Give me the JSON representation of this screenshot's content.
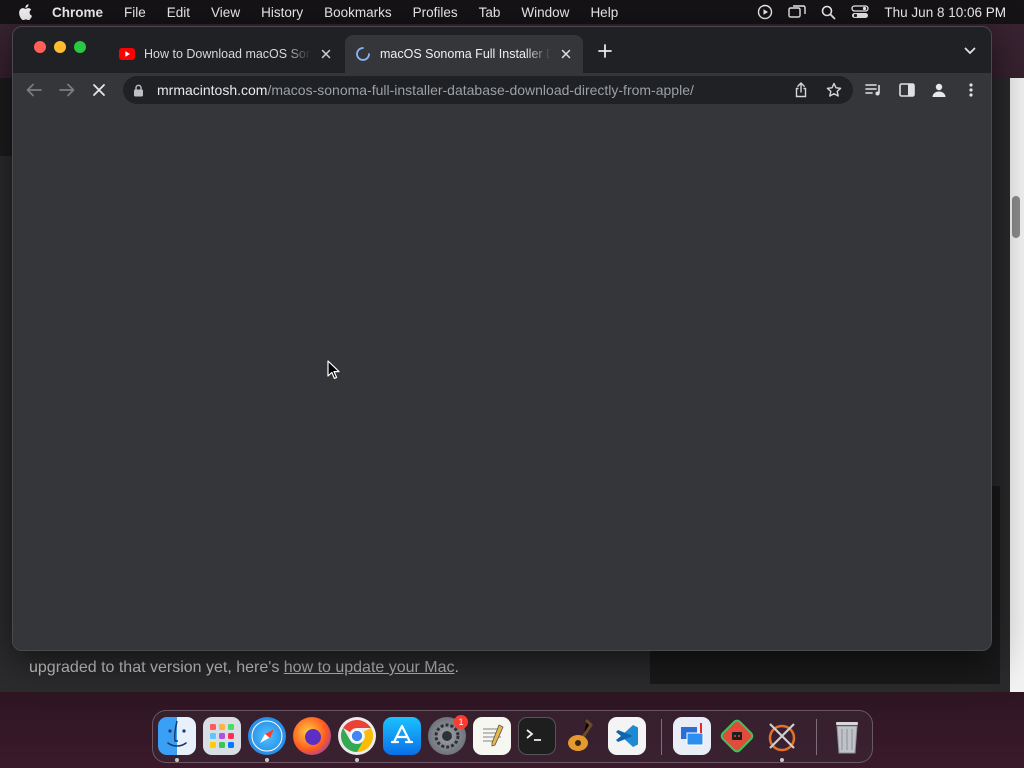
{
  "menubar": {
    "app_name": "Chrome",
    "items": [
      "File",
      "Edit",
      "View",
      "History",
      "Bookmarks",
      "Profiles",
      "Tab",
      "Window",
      "Help"
    ],
    "clock": "Thu Jun 8  10:06 PM"
  },
  "browser": {
    "tabs": [
      {
        "title": "How to Download macOS Sonoma",
        "favicon": "youtube-icon",
        "state": "inactive"
      },
      {
        "title": "macOS Sonoma Full Installer Database",
        "favicon": "loading-spinner-icon",
        "state": "active"
      }
    ],
    "url_host": "mrmacintosh.com",
    "url_path": "/macos-sonoma-full-installer-database-download-directly-from-apple/"
  },
  "background_page": {
    "text_before_link": "upgraded to that version yet, here's ",
    "link_text": "how to update your Mac",
    "text_after_link": "."
  },
  "dock": {
    "apps": [
      {
        "name": "Finder",
        "icon": "finder-icon",
        "running": true
      },
      {
        "name": "Launchpad",
        "icon": "launchpad-icon",
        "running": false
      },
      {
        "name": "Safari",
        "icon": "safari-icon",
        "running": true
      },
      {
        "name": "Firefox",
        "icon": "firefox-icon",
        "running": false
      },
      {
        "name": "Chrome",
        "icon": "chrome-icon",
        "running": true
      },
      {
        "name": "App Store",
        "icon": "app-store-icon",
        "running": false
      },
      {
        "name": "System Settings",
        "icon": "system-settings-icon",
        "running": false,
        "badge": "1"
      },
      {
        "name": "TextEdit",
        "icon": "textedit-icon",
        "running": false
      },
      {
        "name": "Terminal",
        "icon": "terminal-icon",
        "running": false
      },
      {
        "name": "GarageBand",
        "icon": "garageband-icon",
        "running": false
      },
      {
        "name": "VS Code",
        "icon": "vscode-icon",
        "running": false
      },
      {
        "name": "Screen Sharing",
        "icon": "screen-sharing-icon",
        "running": false
      },
      {
        "name": "Dash",
        "icon": "dash-icon",
        "running": false
      },
      {
        "name": "Xcode Tool",
        "icon": "xcode-icon",
        "running": true
      },
      {
        "name": "Trash",
        "icon": "trash-icon",
        "running": false
      }
    ]
  },
  "colors": {
    "toolbar": "#35363a",
    "tabstrip": "#202124",
    "omnibox": "#202124",
    "close_red": "#ff5f57",
    "minimize_yellow": "#febc2e",
    "zoom_green": "#28c840"
  }
}
